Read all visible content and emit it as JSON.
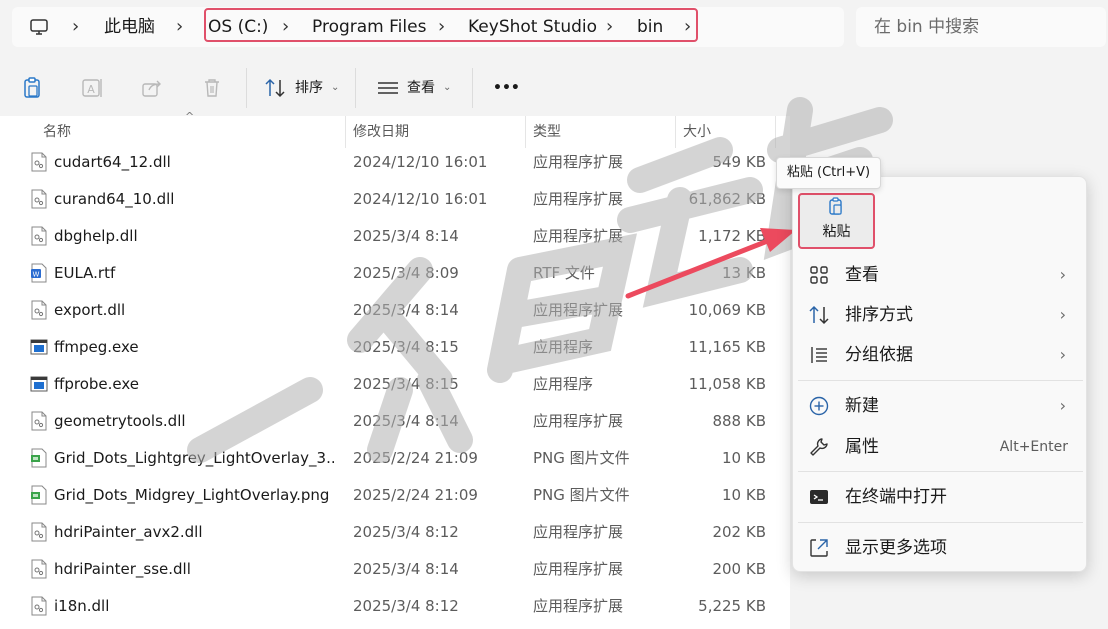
{
  "address": {
    "root": "此电脑",
    "crumbs": [
      "OS (C:)",
      "Program Files",
      "KeyShot Studio",
      "bin"
    ]
  },
  "search": {
    "placeholder": "在 bin 中搜索"
  },
  "toolbar": {
    "sort_label": "排序",
    "view_label": "查看",
    "more_label": "•••"
  },
  "columns": {
    "name": "名称",
    "date": "修改日期",
    "type": "类型",
    "size": "大小"
  },
  "files": [
    {
      "name": "cudart64_12.dll",
      "date": "2024/12/10 16:01",
      "type": "应用程序扩展",
      "size": "549 KB",
      "icon": "dll"
    },
    {
      "name": "curand64_10.dll",
      "date": "2024/12/10 16:01",
      "type": "应用程序扩展",
      "size": "61,862 KB",
      "icon": "dll"
    },
    {
      "name": "dbghelp.dll",
      "date": "2025/3/4 8:14",
      "type": "应用程序扩展",
      "size": "1,172 KB",
      "icon": "dll"
    },
    {
      "name": "EULA.rtf",
      "date": "2025/3/4 8:09",
      "type": "RTF 文件",
      "size": "13 KB",
      "icon": "rtf"
    },
    {
      "name": "export.dll",
      "date": "2025/3/4 8:14",
      "type": "应用程序扩展",
      "size": "10,069 KB",
      "icon": "dll"
    },
    {
      "name": "ffmpeg.exe",
      "date": "2025/3/4 8:15",
      "type": "应用程序",
      "size": "11,165 KB",
      "icon": "exe"
    },
    {
      "name": "ffprobe.exe",
      "date": "2025/3/4 8:15",
      "type": "应用程序",
      "size": "11,058 KB",
      "icon": "exe"
    },
    {
      "name": "geometrytools.dll",
      "date": "2025/3/4 8:14",
      "type": "应用程序扩展",
      "size": "888 KB",
      "icon": "dll"
    },
    {
      "name": "Grid_Dots_Lightgrey_LightOverlay_3...",
      "date": "2025/2/24 21:09",
      "type": "PNG 图片文件",
      "size": "10 KB",
      "icon": "png"
    },
    {
      "name": "Grid_Dots_Midgrey_LightOverlay.png",
      "date": "2025/2/24 21:09",
      "type": "PNG 图片文件",
      "size": "10 KB",
      "icon": "png"
    },
    {
      "name": "hdriPainter_avx2.dll",
      "date": "2025/3/4 8:12",
      "type": "应用程序扩展",
      "size": "202 KB",
      "icon": "dll"
    },
    {
      "name": "hdriPainter_sse.dll",
      "date": "2025/3/4 8:14",
      "type": "应用程序扩展",
      "size": "200 KB",
      "icon": "dll"
    },
    {
      "name": "i18n.dll",
      "date": "2025/3/4 8:12",
      "type": "应用程序扩展",
      "size": "5,225 KB",
      "icon": "dll"
    }
  ],
  "context_menu": {
    "tooltip": "粘贴 (Ctrl+V)",
    "paste_label": "粘贴",
    "items": [
      {
        "label": "查看",
        "icon": "grid-view-icon",
        "submenu": true
      },
      {
        "label": "排序方式",
        "icon": "sort-icon",
        "submenu": true
      },
      {
        "label": "分组依据",
        "icon": "group-icon",
        "submenu": true
      },
      {
        "label": "新建",
        "icon": "plus-circle-icon",
        "submenu": true
      },
      {
        "label": "属性",
        "icon": "wrench-icon",
        "shortcut": "Alt+Enter"
      },
      {
        "label": "在终端中打开",
        "icon": "terminal-icon"
      },
      {
        "label": "显示更多选项",
        "icon": "expand-icon"
      }
    ]
  },
  "watermark": {
    "text": "一个白象专用"
  },
  "colors": {
    "highlight": "#e0506a",
    "arrow": "#ec4a5e",
    "exe_blue": "#1e6fd0"
  }
}
